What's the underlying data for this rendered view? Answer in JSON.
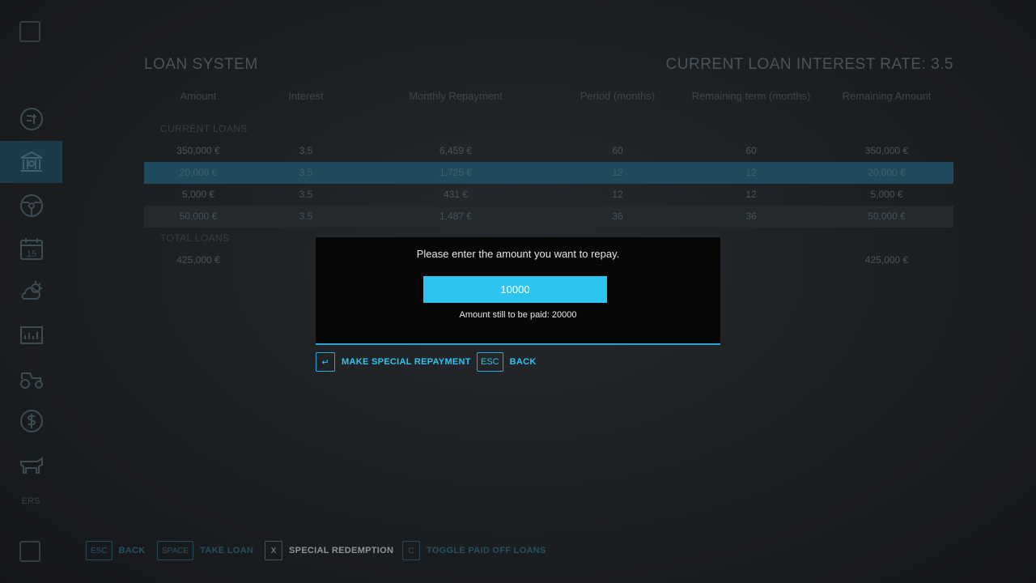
{
  "header": {
    "title": "LOAN SYSTEM",
    "rate_label": "CURRENT LOAN INTEREST RATE: 3.5"
  },
  "table": {
    "columns": [
      "Amount",
      "Interest",
      "Monthly Repayment",
      "Period (months)",
      "Remaining term (months)",
      "Remaining Amount"
    ],
    "current_label": "CURRENT LOANS",
    "rows": [
      [
        "350,000 €",
        "3.5",
        "6,459 €",
        "60",
        "60",
        "350,000 €"
      ],
      [
        "20,000 €",
        "3.5",
        "1,725 €",
        "12",
        "12",
        "20,000 €"
      ],
      [
        "5,000 €",
        "3.5",
        "431 €",
        "12",
        "12",
        "5,000 €"
      ],
      [
        "50,000 €",
        "3.5",
        "1,487 €",
        "36",
        "36",
        "50,000 €"
      ]
    ],
    "total_label": "TOTAL LOANS",
    "total_row": [
      "425,000 €",
      "",
      "",
      "",
      "",
      "425,000 €"
    ]
  },
  "dialog": {
    "prompt": "Please enter the amount you want to repay.",
    "input_value": "10000",
    "remaining_text": "Amount still to be paid: 20000",
    "confirm_key": "↵",
    "confirm_label": "MAKE SPECIAL REPAYMENT",
    "back_key": "ESC",
    "back_label": "BACK"
  },
  "bottom_bar": [
    {
      "key": "ESC",
      "label": "BACK"
    },
    {
      "key": "SPACE",
      "label": "TAKE LOAN"
    },
    {
      "key": "X",
      "label": "SPECIAL REDEMPTION"
    },
    {
      "key": "C",
      "label": "TOGGLE PAID OFF LOANS"
    }
  ],
  "sidebar": {
    "label": "ERS",
    "icons": [
      "prices-icon",
      "bank-icon",
      "steering-wheel-icon",
      "calendar-icon",
      "weather-icon",
      "statistics-icon",
      "vehicles-icon",
      "finances-icon",
      "animals-icon"
    ],
    "calendar_day": "15"
  },
  "colors": {
    "accent": "#2ec4f0",
    "dialog_bg": "#070707",
    "selected_row": "#1f4a5c"
  }
}
